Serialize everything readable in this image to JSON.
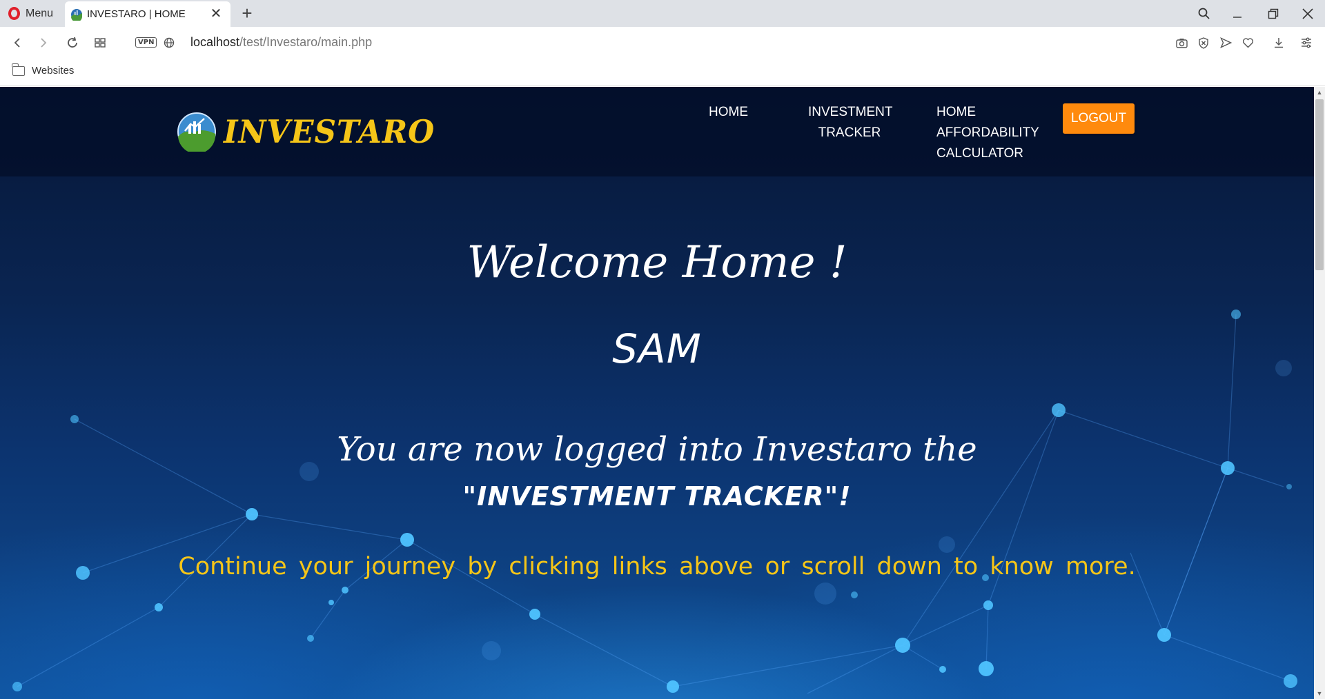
{
  "browser": {
    "menu_label": "Menu",
    "tab_title": "INVESTARO | HOME",
    "url_host": "localhost",
    "url_path": "/test/Investaro/main.php",
    "vpn_label": "VPN",
    "bookmark_folder": "Websites"
  },
  "site": {
    "logo_text": "INVESTARO",
    "nav": {
      "home": "HOME",
      "tracker_line1": "INVESTMENT",
      "tracker_line2": "TRACKER",
      "calc_line1": "HOME",
      "calc_line2": "AFFORDABILITY",
      "calc_line3": "CALCULATOR"
    },
    "logout_label": "LOGOUT"
  },
  "hero": {
    "welcome": "Welcome Home !",
    "username": "SAM",
    "logged_in": "You are now logged into Investaro the",
    "tracker_quote": "\"INVESTMENT TRACKER\"!",
    "continue": "Continue your journey by clicking links above or scroll down to know more."
  },
  "colors": {
    "accent_gold": "#f5c518",
    "logout_orange": "#ff8a0d",
    "background_navy": "#0a2552"
  }
}
